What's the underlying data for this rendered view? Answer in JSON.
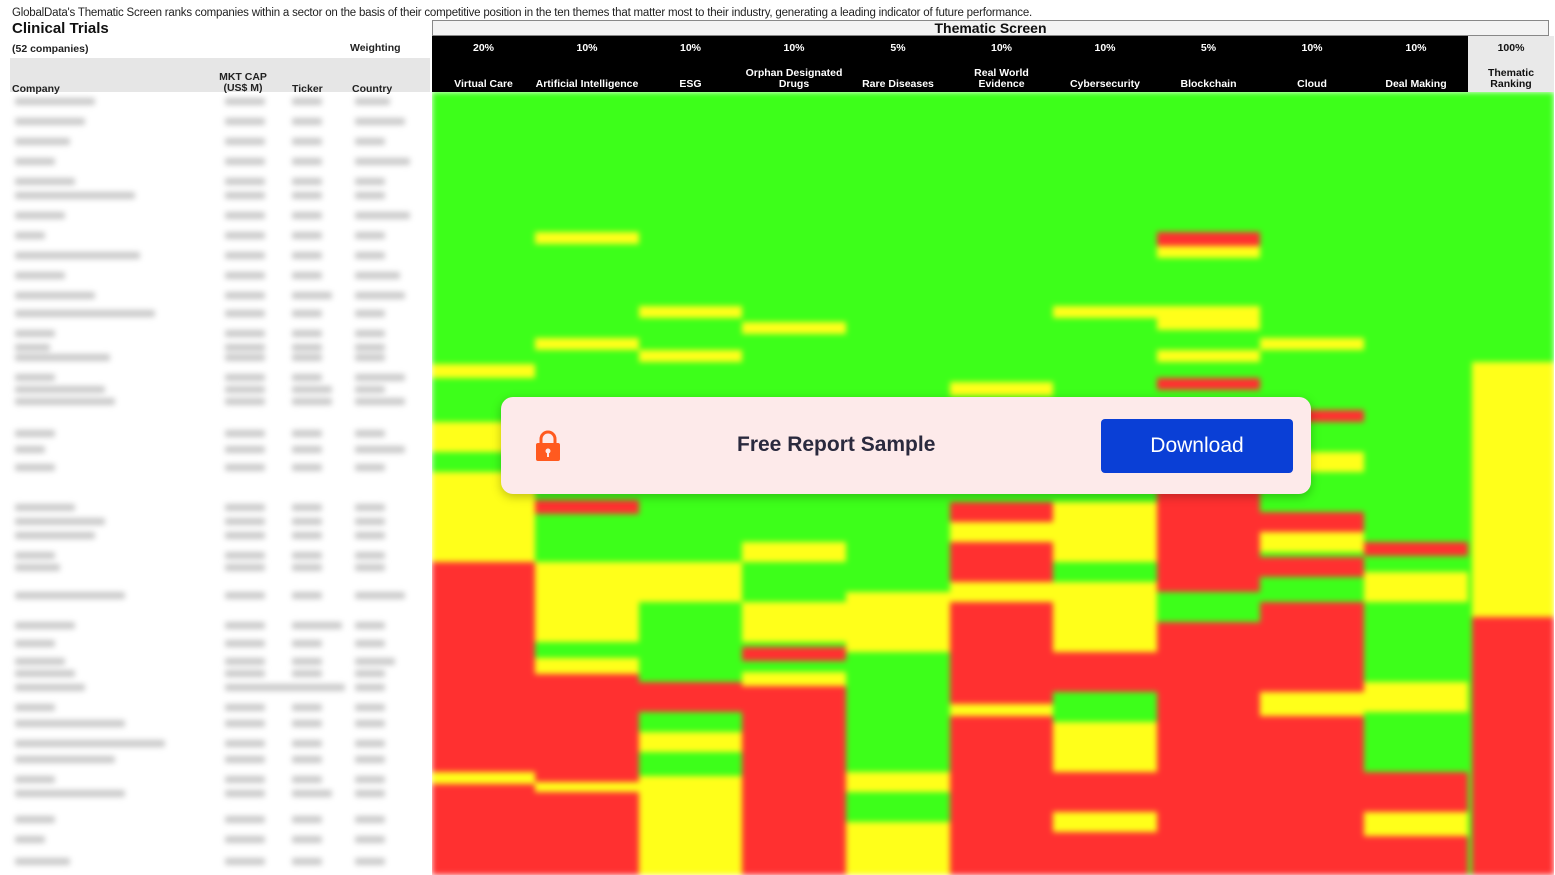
{
  "intro_text": "GlobalData's Thematic Screen ranks companies within a sector on the basis of their competitive position in the  ten themes that matter most to their industry, generating a leading indicator of future performance.",
  "title": "Clinical Trials",
  "company_count": "(52 companies)",
  "weighting_label": "Weighting",
  "columns": {
    "company": "Company",
    "mkt_cap": "MKT CAP (US$ M)",
    "ticker": "Ticker",
    "country": "Country"
  },
  "screen_title": "Thematic Screen",
  "themes": [
    {
      "weight": "20%",
      "name": "Virtual Care"
    },
    {
      "weight": "10%",
      "name": "Artificial Intelligence"
    },
    {
      "weight": "10%",
      "name": "ESG"
    },
    {
      "weight": "10%",
      "name": "Orphan Designated Drugs"
    },
    {
      "weight": "5%",
      "name": "Rare Diseases"
    },
    {
      "weight": "10%",
      "name": "Real World Evidence"
    },
    {
      "weight": "10%",
      "name": "Cybersecurity"
    },
    {
      "weight": "5%",
      "name": "Blockchain"
    },
    {
      "weight": "10%",
      "name": "Cloud"
    },
    {
      "weight": "10%",
      "name": "Deal Making"
    }
  ],
  "ranking": {
    "weight": "100%",
    "name": "Thematic Ranking"
  },
  "colors": {
    "green": "#3dff1a",
    "yellow": "#ffff1a",
    "red": "#ff3030",
    "download_blue": "#0a3fd6",
    "lock_orange": "#ff5a1f"
  },
  "overlay": {
    "icon": "lock-icon",
    "text": "Free Report Sample",
    "button": "Download"
  }
}
